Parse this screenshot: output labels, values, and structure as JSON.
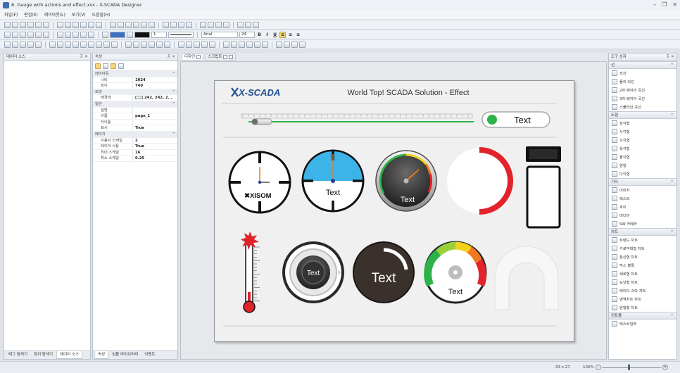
{
  "window": {
    "title": "8. Gauge with actions and effect.xsx - X-SCADA Designer"
  },
  "menu": [
    "파일(F)",
    "편집(E)",
    "레이아웃(L)",
    "보기(V)",
    "도움말(H)"
  ],
  "toolbar": {
    "line_width": "1",
    "font_name": "Arial",
    "font_size": "24",
    "bold_label": "B",
    "italic_label": "I",
    "underline_label": "U"
  },
  "left_panel": {
    "title": "데이터 소스",
    "tabs": [
      "태그 탐색기",
      "장치 탐색기",
      "데이터 소스"
    ]
  },
  "properties": {
    "title": "속성",
    "rows": [
      {
        "kind": "cat",
        "label": "레이아웃"
      },
      {
        "kind": "row",
        "key": "너비",
        "value": "1024"
      },
      {
        "kind": "row",
        "key": "높이",
        "value": "740"
      },
      {
        "kind": "cat",
        "label": "모양"
      },
      {
        "kind": "row",
        "key": "배경색",
        "value": "242, 242, 2...",
        "swatch": true
      },
      {
        "kind": "cat",
        "label": "일반"
      },
      {
        "kind": "row",
        "key": "설명",
        "value": ""
      },
      {
        "kind": "row",
        "key": "이름",
        "value": "page_1"
      },
      {
        "kind": "row",
        "key": "타이틀",
        "value": ""
      },
      {
        "kind": "row",
        "key": "표시",
        "value": "True"
      },
      {
        "kind": "cat",
        "label": "페이지"
      },
      {
        "kind": "row",
        "key": "사용자 스케일",
        "value": "2"
      },
      {
        "kind": "row",
        "key": "레이어 사용",
        "value": "True"
      },
      {
        "kind": "row",
        "key": "최대 스케일",
        "value": "16"
      },
      {
        "kind": "row",
        "key": "최소 스케일",
        "value": "0.25"
      }
    ],
    "tabs": [
      "속성",
      "심볼 라이브러리",
      "이벤트"
    ]
  },
  "document_tabs": [
    "디자인",
    "스크립트"
  ],
  "canvas": {
    "logo": "X-SCADA",
    "title": "World Top! SCADA Solution - Effect",
    "toggle_text": "Text",
    "gauge2_text": "Text",
    "gauge3_text": "Text",
    "knob_text": "Text",
    "dark_dial_text": "Text",
    "color_gauge_text": "Text",
    "clock_logo": "XISOM",
    "slider_value": 0.05
  },
  "colors": {
    "accent_blue": "#3cb4e8",
    "alarm_red": "#e2232b",
    "indicator_green": "#2db24a",
    "needle_orange": "#f07820"
  },
  "toolbox": {
    "title": "도구 상자",
    "groups": [
      {
        "name": "선",
        "items": [
          "직선",
          "폴리 라인",
          "2차 베지어 곡선",
          "3차 베지어 곡선",
          "스플라인 곡선"
        ]
      },
      {
        "name": "도형",
        "items": [
          "삼각형",
          "사각형",
          "오각형",
          "육각형",
          "팔각형",
          "원형",
          "다각형"
        ]
      },
      {
        "name": "기타",
        "items": [
          "이미지",
          "텍스트",
          "호이",
          "미디어",
          "SW 카메라"
        ]
      },
      {
        "name": "차트",
        "items": [
          "트렌드 차트",
          "가로막대형 차트",
          "분산형 차트",
          "막스 블록",
          "세로형 차트",
          "도넛형 차트",
          "레이더 스타 차트",
          "영역차트 차트",
          "원형형 차트"
        ]
      },
      {
        "name": "컨트롤",
        "items": [
          "텍스트입력"
        ]
      }
    ]
  },
  "status": {
    "coords": "-33 x 27",
    "zoom": "100%"
  }
}
